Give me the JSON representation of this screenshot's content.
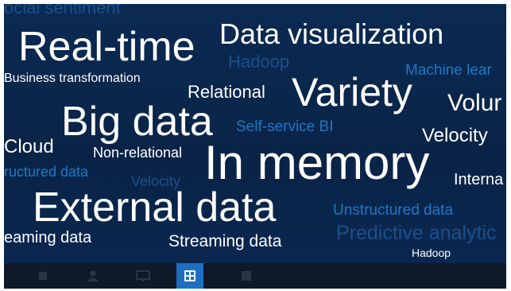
{
  "word_cloud": {
    "top_partial": "ocial sentiment",
    "real_time": "Real-time",
    "data_visualization": "Data visualization",
    "hadoop_dim": "Hadoop",
    "machine_learning": "Machine lear",
    "business_transformation": "Business transformation",
    "relational": "Relational",
    "variety": "Variety",
    "volume": "Volur",
    "big_data": "Big data",
    "self_service_bi": "Self-service BI",
    "velocity": "Velocity",
    "cloud": "Cloud",
    "non_relational": "Non-relational",
    "in_memory": "In memory",
    "internal": "Interna",
    "structured_data": "ructured data",
    "velocity_dim": "Velocity",
    "external_data": "External data",
    "unstructured_data": "Unstructured data",
    "streaming_left": "eaming data",
    "streaming_data": "Streaming data",
    "predictive": "Predictive analytic",
    "hadoop_bottom": "Hadoop"
  },
  "taskbar": {
    "icons": [
      "tile-icon",
      "user-icon",
      "monitor-icon",
      "app-icon",
      "book-icon"
    ],
    "active_icon": "app-icon"
  },
  "colors": {
    "background": "#0a2548",
    "text_white": "#ffffff",
    "text_blue": "#1f78c8",
    "text_dim": "#1b4f8c",
    "taskbar": "#0e1a2a",
    "taskbar_active": "#1e6fc0"
  }
}
